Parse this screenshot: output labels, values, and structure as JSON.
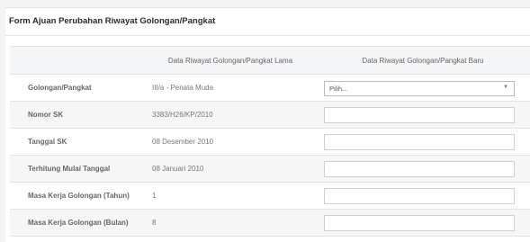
{
  "form": {
    "title": "Form Ajuan Perubahan Riwayat Golongan/Pangkat",
    "columns": {
      "old": "Data Riwayat Golongan/Pangkat Lama",
      "new": "Data Riwayat Golongan/Pangkat Baru"
    },
    "rows": [
      {
        "label": "Golongan/Pangkat",
        "old_value": "III/a - Penata Muda",
        "input_type": "select",
        "placeholder": "Pilih..."
      },
      {
        "label": "Nomor SK",
        "old_value": "3383/H26/KP/2010",
        "input_type": "text",
        "value": ""
      },
      {
        "label": "Tanggal SK",
        "old_value": "08 Desember 2010",
        "input_type": "text",
        "value": ""
      },
      {
        "label": "Terhitung Mulai Tanggal",
        "old_value": "08 Januari 2010",
        "input_type": "text",
        "value": ""
      },
      {
        "label": "Masa Kerja Golongan (Tahun)",
        "old_value": "1",
        "input_type": "text",
        "value": ""
      },
      {
        "label": "Masa Kerja Golongan (Bulan)",
        "old_value": "8",
        "input_type": "text",
        "value": ""
      }
    ]
  }
}
